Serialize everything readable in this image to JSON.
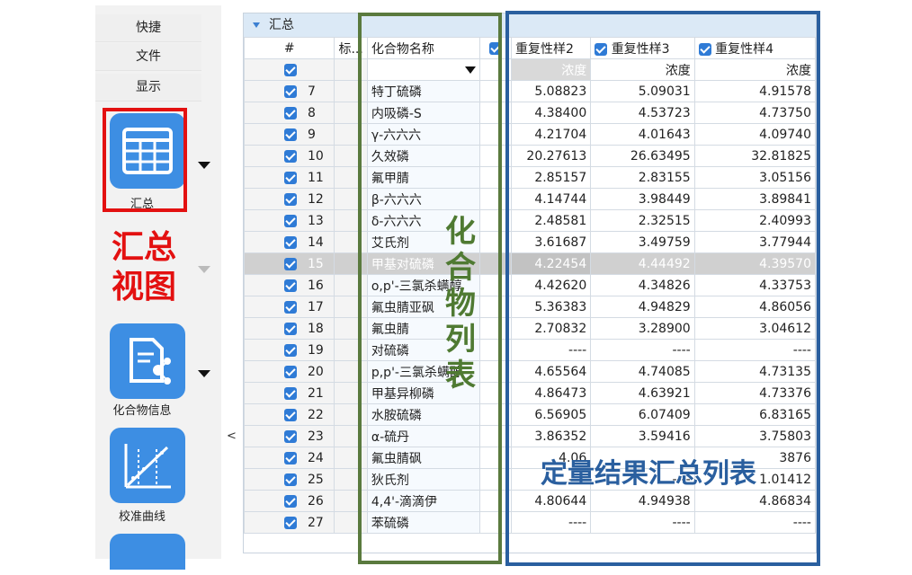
{
  "ribbon": {
    "tabs": [
      "快捷",
      "文件",
      "显示"
    ],
    "summary_label": "汇总",
    "compound_info_label": "化合物信息",
    "calibration_label": "校准曲线",
    "collapse_glyph": "<"
  },
  "annotations": {
    "summary_view": "汇总视图",
    "compound_list": "化合物列表",
    "quant_table": "定量结果汇总列表"
  },
  "grid": {
    "group_title": "汇总",
    "headers": {
      "index": "#",
      "standard": "标...",
      "compound": "化合物名称",
      "rep2": "重复性样2",
      "rep3": "重复性样3",
      "rep4": "重复性样4"
    },
    "sub_header": "浓度",
    "rows": [
      {
        "n": "7",
        "name": "特丁硫磷",
        "r2": "5.08823",
        "r3": "5.09031",
        "r4": "4.91578"
      },
      {
        "n": "8",
        "name": "内吸磷-S",
        "r2": "4.38400",
        "r3": "4.53723",
        "r4": "4.73750"
      },
      {
        "n": "9",
        "name": "γ-六六六",
        "r2": "4.21704",
        "r3": "4.01643",
        "r4": "4.09740"
      },
      {
        "n": "10",
        "name": "久效磷",
        "r2": "20.27613",
        "r3": "26.63495",
        "r4": "32.81825"
      },
      {
        "n": "11",
        "name": "氟甲腈",
        "r2": "2.85157",
        "r3": "2.83155",
        "r4": "3.05156"
      },
      {
        "n": "12",
        "name": "β-六六六",
        "r2": "4.14744",
        "r3": "3.98449",
        "r4": "3.89841"
      },
      {
        "n": "13",
        "name": "δ-六六六",
        "r2": "2.48581",
        "r3": "2.32515",
        "r4": "2.40993"
      },
      {
        "n": "14",
        "name": "艾氏剂",
        "r2": "3.61687",
        "r3": "3.49759",
        "r4": "3.77944"
      },
      {
        "n": "15",
        "name": "甲基对硫磷",
        "r2": "4.22454",
        "r3": "4.44492",
        "r4": "4.39570"
      },
      {
        "n": "16",
        "name": "o,p'-三氯杀螨醇",
        "r2": "4.42620",
        "r3": "4.34826",
        "r4": "4.33753"
      },
      {
        "n": "17",
        "name": "氟虫腈亚砜",
        "r2": "5.36383",
        "r3": "4.94829",
        "r4": "4.86056"
      },
      {
        "n": "18",
        "name": "氟虫腈",
        "r2": "2.70832",
        "r3": "3.28900",
        "r4": "3.04612"
      },
      {
        "n": "19",
        "name": "对硫磷",
        "r2": "----",
        "r3": "----",
        "r4": "----"
      },
      {
        "n": "20",
        "name": "p,p'-三氯杀螨醇",
        "r2": "4.65564",
        "r3": "4.74085",
        "r4": "4.73135"
      },
      {
        "n": "21",
        "name": "甲基异柳磷",
        "r2": "4.86473",
        "r3": "4.63921",
        "r4": "4.73376"
      },
      {
        "n": "22",
        "name": "水胺硫磷",
        "r2": "6.56905",
        "r3": "6.07409",
        "r4": "6.83165"
      },
      {
        "n": "23",
        "name": "α-硫丹",
        "r2": "3.86352",
        "r3": "3.59416",
        "r4": "3.75803"
      },
      {
        "n": "24",
        "name": "氟虫腈砜",
        "r2": "4.06",
        "r3": "",
        "r4": "3876"
      },
      {
        "n": "25",
        "name": "狄氏剂",
        "r2": "----",
        "r3": "----",
        "r4": "1.01412"
      },
      {
        "n": "26",
        "name": "4,4'-滴滴伊",
        "r2": "4.80644",
        "r3": "4.94938",
        "r4": "4.86834"
      },
      {
        "n": "27",
        "name": "苯硫磷",
        "r2": "----",
        "r3": "----",
        "r4": "----"
      }
    ]
  },
  "colors": {
    "accent_blue": "#2f7bd6",
    "annotation_red": "#e31111",
    "annotation_green": "#4f7a32",
    "annotation_navy": "#2a5f9f"
  }
}
